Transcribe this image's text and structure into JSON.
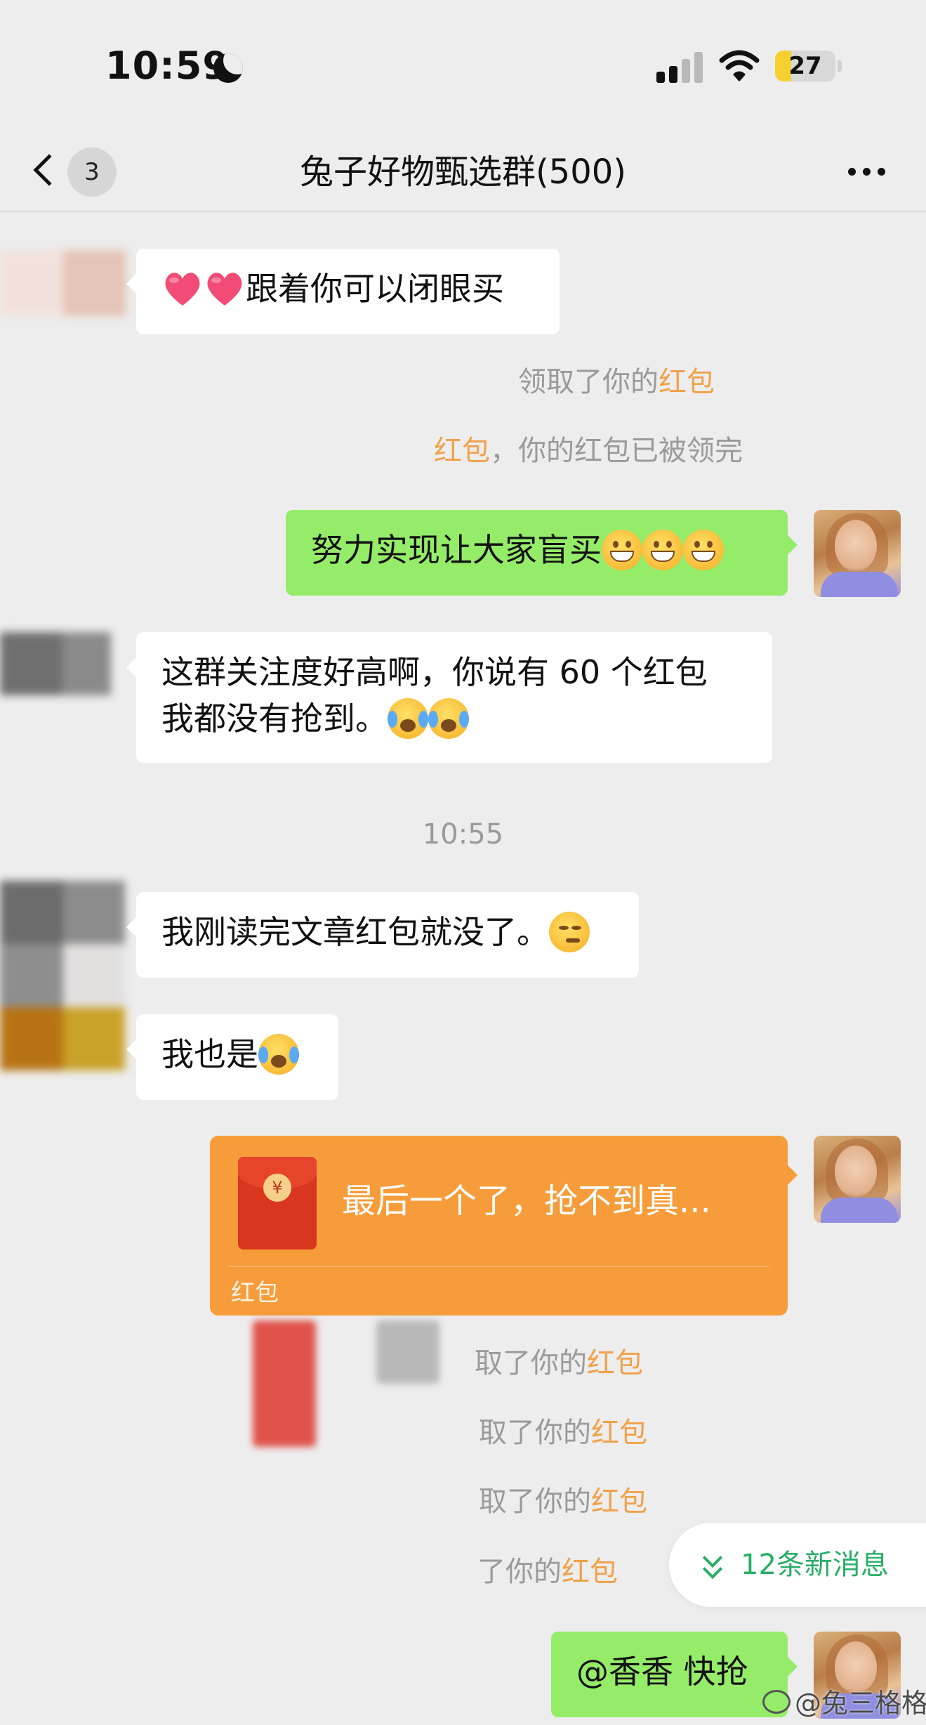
{
  "status_bar": {
    "time": "10:59",
    "battery": "27",
    "battery_fraction": 0.27
  },
  "nav": {
    "unread_count": "3",
    "title": "兔子好物甄选群(500)"
  },
  "messages": {
    "m1_text": "跟着你可以闭眼买",
    "sys1_prefix": "领取了你的",
    "sys1_link": "红包",
    "sys2_link": "红包",
    "sys2_suffix": "，你的红包已被领完",
    "m2_text": "努力实现让大家盲买",
    "m3_line1": "这群关注度好高啊，你说有 60 个红包",
    "m3_line2": "我都没有抢到。",
    "timestamp": "10:55",
    "m4_text": "我刚读完文章红包就没了。",
    "m5_text": "我也是",
    "red_packet_title": "最后一个了，抢不到真...",
    "red_packet_label": "红包",
    "sys3_prefix": "取了你的",
    "sys3_link": "红包",
    "sys4_prefix": "取了你的",
    "sys4_link": "红包",
    "sys5_prefix": "取了你的",
    "sys5_link": "红包",
    "sys6_prefix": "了你的",
    "sys6_link": "红包",
    "m6_text": "@香香 快抢"
  },
  "new_messages": {
    "label": "12条新消息"
  },
  "watermark": {
    "text": "@兔三格格"
  },
  "colors": {
    "background": "#ededed",
    "my_bubble": "#95ec69",
    "other_bubble": "#ffffff",
    "red_packet": "#f79c3a",
    "red_packet_link": "#f0a14a",
    "new_msg_accent": "#2aae67",
    "system_text": "#9a9a9a"
  },
  "icons": [
    "moon-icon",
    "signal-icon",
    "wifi-icon",
    "battery-icon",
    "back-chevron-icon",
    "more-icon",
    "heart-emoji",
    "grin-emoji",
    "crying-laughing-emoji",
    "smirk-emoji",
    "red-packet-icon",
    "double-chevron-down-icon",
    "weibo-icon"
  ]
}
